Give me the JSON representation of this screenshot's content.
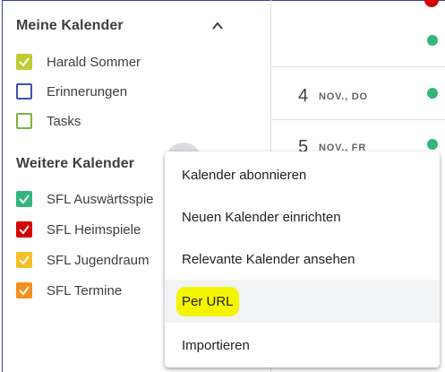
{
  "sidebar": {
    "my_calendars_title": "Meine Kalender",
    "my_calendars": [
      {
        "label": "Harald Sommer",
        "checked": true,
        "color": "#c0ca33"
      },
      {
        "label": "Erinnerungen",
        "checked": false,
        "color": "#3f51b5"
      },
      {
        "label": "Tasks",
        "checked": false,
        "color": "#7cb342"
      }
    ],
    "other_calendars_title": "Weitere Kalender",
    "other_calendars": [
      {
        "label": "SFL Auswärtsspie",
        "checked": true,
        "color": "#33b679"
      },
      {
        "label": "SFL Heimspiele",
        "checked": true,
        "color": "#d50000"
      },
      {
        "label": "SFL Jugendraum",
        "checked": true,
        "color": "#f6bf26"
      },
      {
        "label": "SFL Termine",
        "checked": true,
        "color": "#f4911e"
      }
    ]
  },
  "agenda": {
    "days": [
      {
        "num": "4",
        "name": "NOV., DO"
      },
      {
        "num": "5",
        "name": "NOV., FR"
      }
    ],
    "event_color": "#33b679"
  },
  "menu": {
    "items": [
      {
        "label": "Kalender abonnieren"
      },
      {
        "label": "Neuen Kalender einrichten"
      },
      {
        "label": "Relevante Kalender ansehen"
      },
      {
        "label": "Per URL",
        "highlighted": true
      },
      {
        "label": "Importieren"
      }
    ]
  },
  "icons": {
    "collapse": "chevron-up-icon",
    "check": "check-icon"
  }
}
